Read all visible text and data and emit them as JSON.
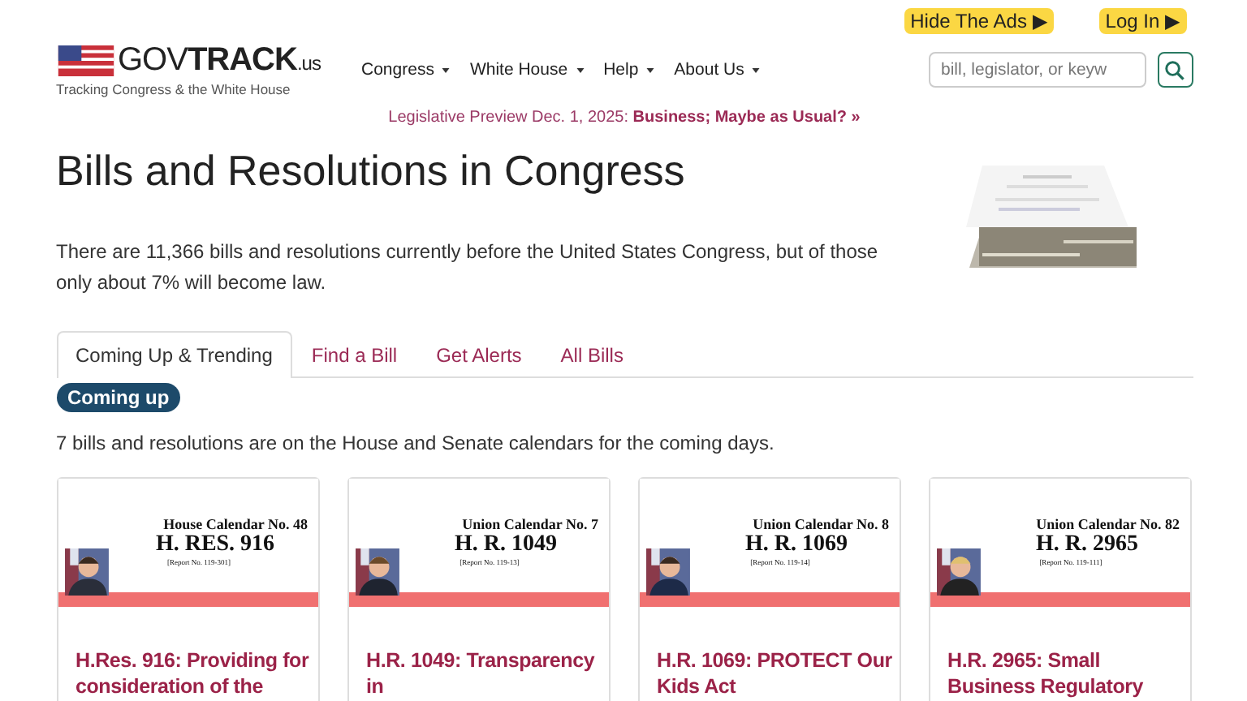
{
  "top_links": [
    {
      "label": "Hide The Ads ▶"
    },
    {
      "label": "Log In ▶"
    }
  ],
  "logo": {
    "wordmark": "GOV**TRACK**$_{.us}$",
    "tagline": "Tracking Congress & the White House"
  },
  "nav": [
    {
      "label": "Congress"
    },
    {
      "label": "White House"
    },
    {
      "label": "Help"
    },
    {
      "label": "About Us"
    }
  ],
  "search": {
    "placeholder": "bill, legislator, or keyw"
  },
  "announcement": {
    "prefix": "Legislative Preview Dec. 1, 2025:",
    "link": "Business; Maybe as Usual? »"
  },
  "title": "Bills and Resolutions in Congress",
  "intro": "There are 11,366 bills and resolutions currently before the United States Congress, but of those only about 7% will become law.",
  "tabs": [
    {
      "label": "Coming Up & Trending",
      "selected": true
    },
    {
      "label": "Find a Bill",
      "selected": false
    },
    {
      "label": "Get Alerts",
      "selected": false
    },
    {
      "label": "All Bills",
      "selected": false
    }
  ],
  "section_badge": "Coming up",
  "summary": "7 bills and resolutions are on the House and Senate calendars for the coming days.",
  "bills": [
    {
      "calendar": "House Calendar No. 48",
      "number": "H. RES. 916",
      "report": "[Report No. 119-301]",
      "title": "H.Res. 916: Providing for consideration of the"
    },
    {
      "calendar": "Union Calendar No. 7",
      "number": "H. R. 1049",
      "report": "[Report No. 119-13]",
      "title": "H.R. 1049: Transparency in"
    },
    {
      "calendar": "Union Calendar No. 8",
      "number": "H. R. 1069",
      "report": "[Report No. 119-14]",
      "title": "H.R. 1069: PROTECT Our Kids Act"
    },
    {
      "calendar": "Union Calendar No. 82",
      "number": "H. R. 2965",
      "report": "[Report No. 119-111]",
      "title": "H.R. 2965: Small Business Regulatory"
    }
  ]
}
